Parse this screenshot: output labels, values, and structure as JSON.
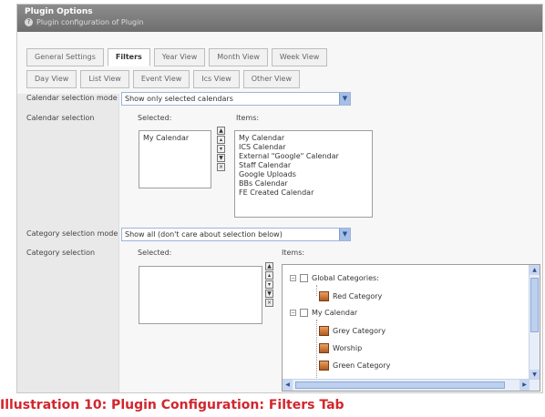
{
  "header": {
    "title": "Plugin Options",
    "subtitle": "Plugin configuration of Plugin",
    "help_icon": "help-icon"
  },
  "tabs_row1": [
    "General Settings",
    "Filters",
    "Year View",
    "Month View",
    "Week View"
  ],
  "tabs_row2": [
    "Day View",
    "List View",
    "Event View",
    "Ics View",
    "Other View"
  ],
  "active_tab": "Filters",
  "calendar_mode": {
    "label": "Calendar selection mode",
    "value": "Show only selected calendars"
  },
  "calendar_selection": {
    "label": "Calendar selection",
    "selected_label": "Selected:",
    "items_label": "Items:",
    "selected": [
      "My Calendar"
    ],
    "items": [
      "My Calendar",
      "ICS Calendar",
      "External \"Google\" Calendar",
      "Staff Calendar",
      "Google Uploads",
      "BBs Calendar",
      "FE Created Calendar"
    ]
  },
  "category_mode": {
    "label": "Category selection mode",
    "value": "Show all (don't care about selection below)"
  },
  "category_selection": {
    "label": "Category selection",
    "selected_label": "Selected:",
    "items_label": "Items:",
    "tree": {
      "group1": "Global Categories:",
      "group1_items": [
        "Red Category"
      ],
      "group2": "My Calendar",
      "group2_items": [
        "Grey Category",
        "Worship",
        "Green Category"
      ]
    }
  },
  "caption": "Illustration 10: Plugin Configuration: Filters Tab"
}
